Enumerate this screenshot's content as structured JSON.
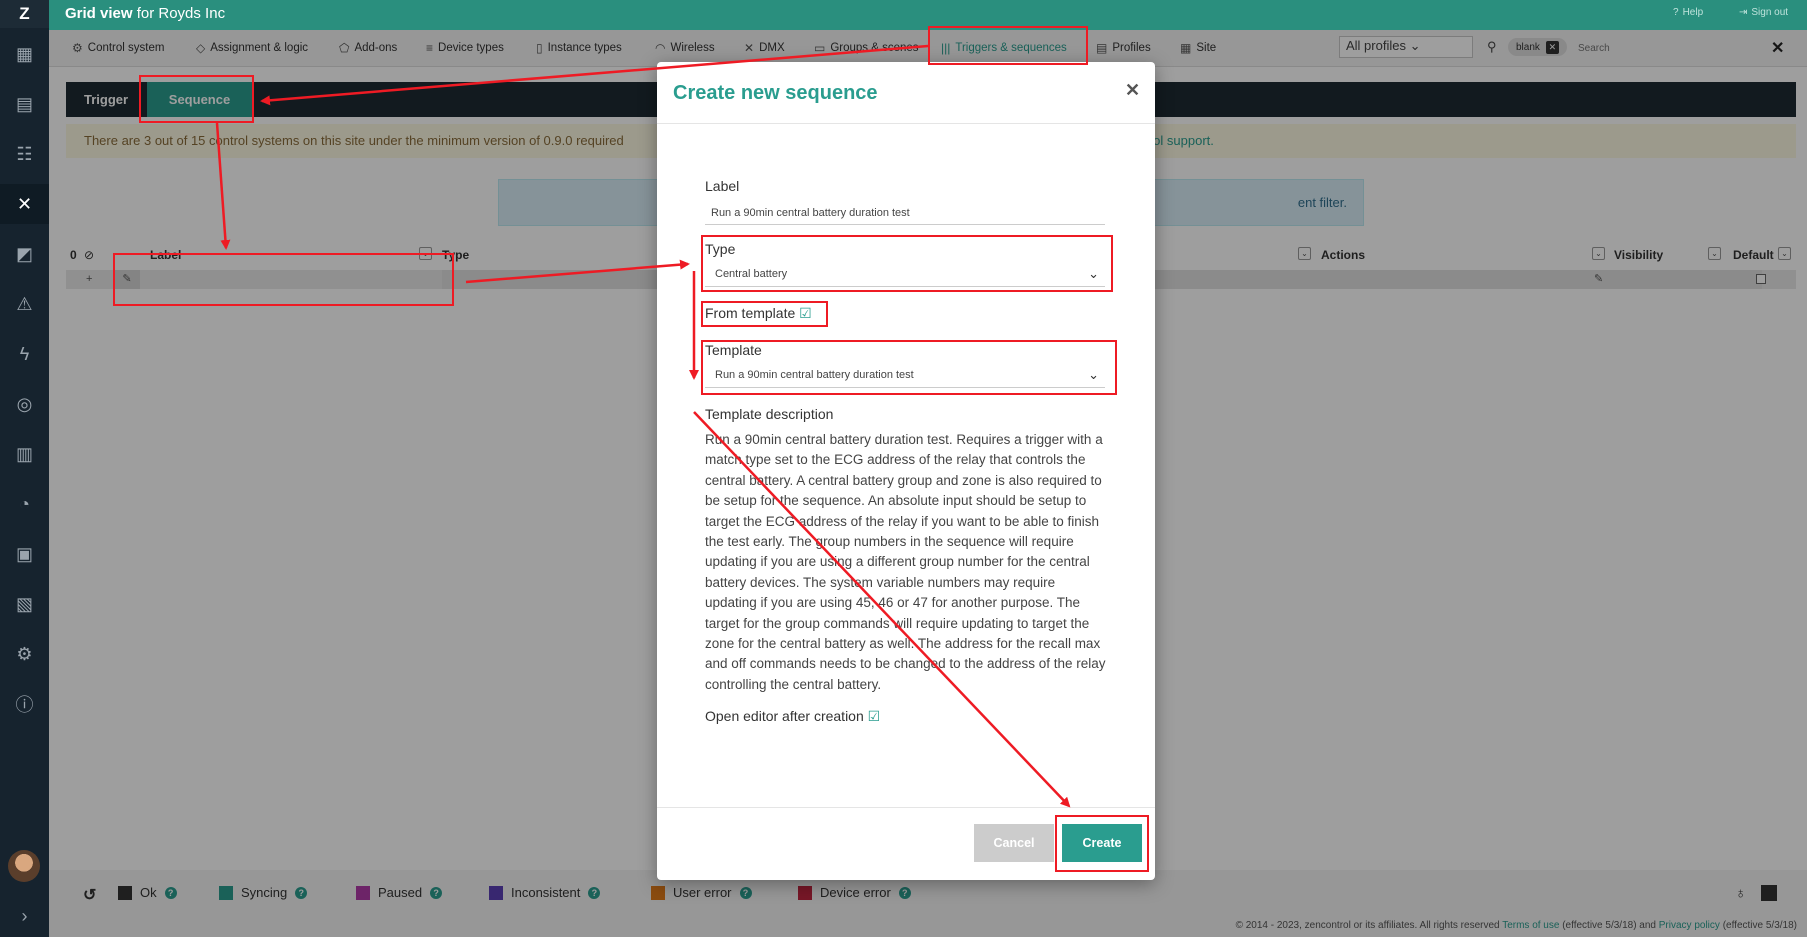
{
  "app": {
    "logo": "Z",
    "title_bold": "Grid view",
    "title_rest": "for Royds Inc",
    "help": "Help",
    "signout": "Sign out"
  },
  "sidebar": {
    "icons": [
      "grid-view-icon",
      "control-panel-icon",
      "users-icon",
      "tools-icon",
      "analytics-icon",
      "warning-icon",
      "power-icon",
      "alarm-icon",
      "reports-icon",
      "history-icon",
      "clipboard-icon",
      "checklist-icon",
      "settings-icon",
      "info-icon"
    ]
  },
  "nav": {
    "items": [
      {
        "label": "Control system",
        "icon": "gear-icon"
      },
      {
        "label": "Assignment & logic",
        "icon": "assignment-icon"
      },
      {
        "label": "Add-ons",
        "icon": "addons-icon"
      },
      {
        "label": "Device types",
        "icon": "device-types-icon"
      },
      {
        "label": "Instance types",
        "icon": "instance-types-icon"
      },
      {
        "label": "Wireless",
        "icon": "wifi-icon"
      },
      {
        "label": "DMX",
        "icon": "dmx-icon"
      },
      {
        "label": "Groups & scenes",
        "icon": "groups-icon"
      },
      {
        "label": "Triggers & sequences",
        "icon": "triggers-icon"
      },
      {
        "label": "Profiles",
        "icon": "profiles-icon"
      },
      {
        "label": "Site",
        "icon": "site-icon"
      }
    ],
    "profile_select": "All profiles",
    "filter_chip": "blank",
    "search_placeholder": "Search"
  },
  "tabs": {
    "trigger": "Trigger",
    "sequence": "Sequence"
  },
  "banner": {
    "text_start": "There are 3 out of 15 control systems on this site under the minimum version of 0.9.0 required",
    "text_end": "ntrol support."
  },
  "infobar": {
    "text_end": "ent filter."
  },
  "grid": {
    "count": "0",
    "columns": {
      "label": "Label",
      "type": "Type",
      "actions": "Actions",
      "visibility": "Visibility",
      "default": "Default"
    },
    "add_row": "+"
  },
  "modal": {
    "title": "Create new sequence",
    "label_label": "Label",
    "label_value": "Run a 90min central battery duration test",
    "type_label": "Type",
    "type_value": "Central battery",
    "from_template_label": "From template",
    "template_label": "Template",
    "template_value": "Run a 90min central battery duration test",
    "template_desc_label": "Template description",
    "template_desc": "Run a 90min central battery duration test. Requires a trigger with a match type set to the ECG address of the relay that controls the central battery. A central battery group and zone is also required to be setup for the sequence. An absolute input should be setup to target the ECG address of the relay if you want to be able to finish the test early. The group numbers in the sequence will require updating if you are using a different group number for the central battery devices. The system variable numbers may require updating if you are using 45, 46 or 47 for another purpose. The target for the group commands will require updating to target the zone for the central battery as well. The address for the recall max and off commands needs to be changed to the address of the relay controlling the central battery.",
    "open_editor_label": "Open editor after creation",
    "cancel": "Cancel",
    "create": "Create"
  },
  "status": {
    "items": [
      {
        "label": "Ok",
        "color": "#333333"
      },
      {
        "label": "Syncing",
        "color": "#2a9d8f"
      },
      {
        "label": "Paused",
        "color": "#b03aa8"
      },
      {
        "label": "Inconsistent",
        "color": "#5b3fb5"
      },
      {
        "label": "User error",
        "color": "#e07b1b"
      },
      {
        "label": "Device error",
        "color": "#c0263f"
      }
    ]
  },
  "footer": {
    "copyright": "© 2014 - 2023, zencontrol or its affiliates. All rights reserved",
    "terms": "Terms of use",
    "terms_eff": "(effective 5/3/18) and",
    "privacy": "Privacy policy",
    "privacy_eff": "(effective 5/3/18)"
  },
  "colors": {
    "accent": "#2a9d8f",
    "annotation": "#ee1b24",
    "sidebar": "#16232e"
  }
}
